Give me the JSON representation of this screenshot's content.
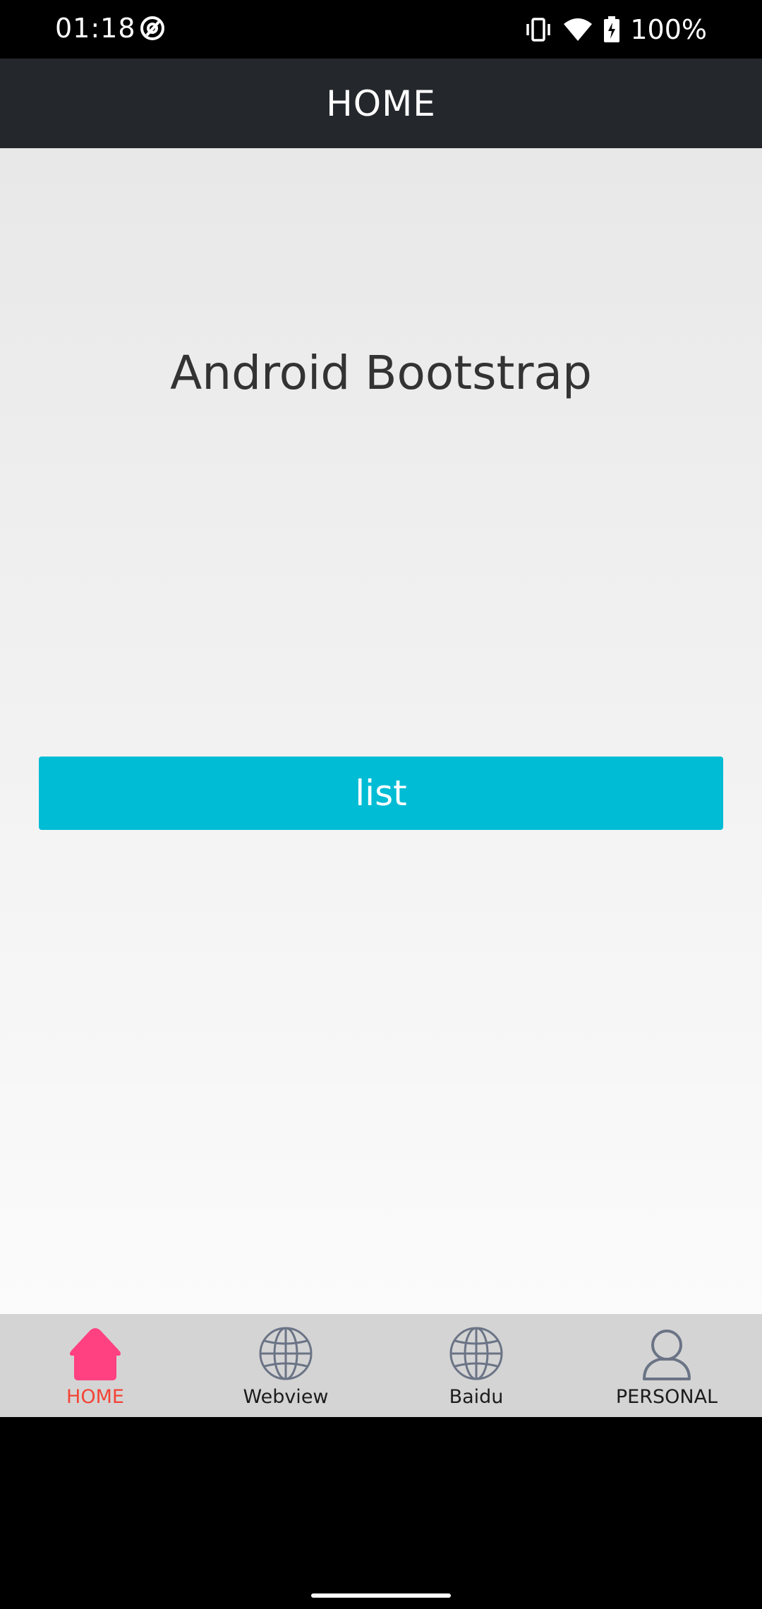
{
  "status_bar": {
    "time": "01:18",
    "battery_text": "100%",
    "icons": [
      "at-sign-icon",
      "vibrate-icon",
      "wifi-icon",
      "battery-charging-icon"
    ]
  },
  "app_bar": {
    "title": "HOME"
  },
  "main": {
    "headline": "Android Bootstrap",
    "list_button_label": "list",
    "accent_color": "#00bcd4"
  },
  "tabs": [
    {
      "label": "HOME",
      "icon": "home-icon",
      "active": true,
      "color": "#ff4081"
    },
    {
      "label": "Webview",
      "icon": "globe-icon",
      "active": false
    },
    {
      "label": "Baidu",
      "icon": "globe-icon",
      "active": false
    },
    {
      "label": "PERSONAL",
      "icon": "person-icon",
      "active": false
    }
  ]
}
